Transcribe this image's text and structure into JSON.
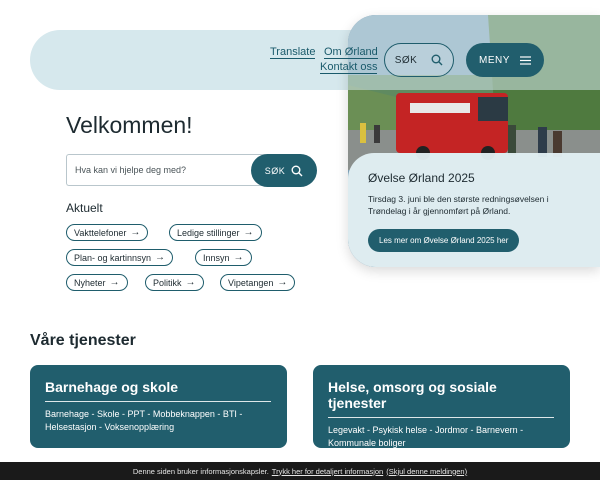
{
  "header": {
    "translate": "Translate",
    "om": "Om Ørland",
    "kontakt": "Kontakt oss",
    "search_label": "SØK",
    "menu_label": "MENY"
  },
  "hero": {
    "title": "Øvelse Ørland 2025",
    "text": "Tirsdag 3. juni ble den største redningsøvelsen i Trøndelag i år gjennomført på Ørland.",
    "button": "Les mer om Øvelse Ørland 2025 her"
  },
  "welcome": "Velkommen!",
  "search": {
    "placeholder": "Hva kan vi hjelpe deg med?",
    "button": "SØK"
  },
  "aktuelt": {
    "heading": "Aktuelt",
    "chips": [
      "Vakttelefoner",
      "Ledige stillinger",
      "Plan- og kartinnsyn",
      "Innsyn",
      "Nyheter",
      "Politikk",
      "Vipetangen"
    ]
  },
  "services": {
    "heading": "Våre tjenester",
    "cards": [
      {
        "title": "Barnehage og skole",
        "links": "Barnehage - Skole - PPT - Mobbeknappen - BTI - Helsestasjon - Voksenopplæring"
      },
      {
        "title": "Helse, omsorg og sosiale tjenester",
        "links": "Legevakt - Psykisk helse - Jordmor - Barnevern - Kommunale boliger"
      }
    ]
  },
  "cookie": {
    "text": "Denne siden bruker informasjonskapsler.",
    "more": "Trykk her for detaljert informasjon",
    "hide": "(Skjul denne meldingen)"
  },
  "colors": {
    "primary": "#215e6d",
    "header_bg": "#d6e8ed",
    "cookie_bg": "#1a1a1a"
  }
}
